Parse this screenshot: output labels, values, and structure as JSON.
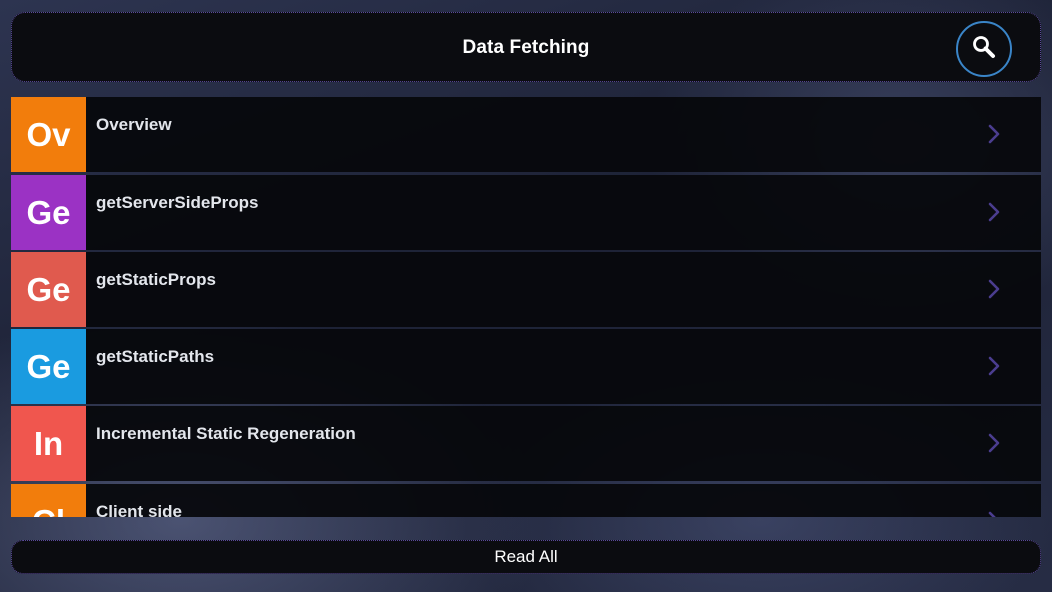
{
  "header": {
    "title": "Data Fetching",
    "search_icon": "search-icon"
  },
  "items": [
    {
      "badge": "Ov",
      "label": "Overview",
      "color": "#f27d0c"
    },
    {
      "badge": "Ge",
      "label": "getServerSideProps",
      "color": "#9b32c4"
    },
    {
      "badge": "Ge",
      "label": "getStaticProps",
      "color": "#e05a4e"
    },
    {
      "badge": "Ge",
      "label": "getStaticPaths",
      "color": "#1a9be0"
    },
    {
      "badge": "In",
      "label": "Incremental Static Regeneration",
      "color": "#f0564e"
    },
    {
      "badge": "Cl",
      "label": "Client side",
      "color": "#f27d0c"
    }
  ],
  "footer": {
    "read_all_label": "Read All"
  },
  "colors": {
    "accent_border": "#5a4a9a",
    "search_ring": "#3a85c8",
    "chevron": "#4b3d8f"
  }
}
